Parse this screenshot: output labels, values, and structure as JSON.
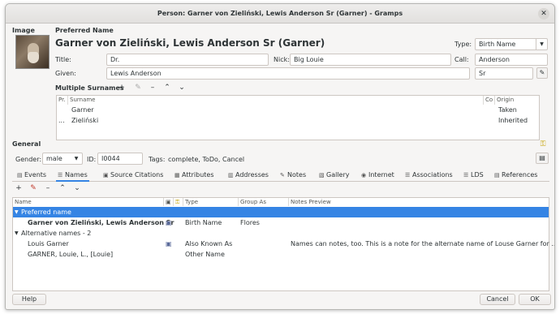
{
  "window": {
    "title": "Person: Garner von Zieliński, Lewis Anderson Sr (Garner) - Gramps"
  },
  "image_label": "Image",
  "preferred": {
    "section_label": "Preferred Name",
    "display_name": "Garner von Zieliński, Lewis Anderson Sr (Garner)",
    "type_label": "Type:",
    "type_value": "Birth Name",
    "title_label": "Title:",
    "title_value": "Dr.",
    "nick_label": "Nick:",
    "nick_value": "Big Louie",
    "call_label": "Call:",
    "call_value": "Anderson",
    "given_label": "Given:",
    "given_value": "Lewis Anderson",
    "suffix_value": "Sr"
  },
  "surnames": {
    "section_label": "Multiple Surnames",
    "col_pr": "Pr.",
    "col_surname": "Surname",
    "col_co": "Co",
    "col_origin": "Origin",
    "rows": [
      {
        "prefix": "",
        "surname": "Garner",
        "origin": "Taken"
      },
      {
        "prefix": "...",
        "surname": "Zieliński",
        "origin": "Inherited"
      }
    ]
  },
  "general": {
    "section_label": "General",
    "gender_label": "Gender:",
    "gender_value": "male",
    "id_label": "ID:",
    "id_value": "I0044",
    "tags_label": "Tags:",
    "tags_value": "complete, ToDo, Cancel"
  },
  "tabs": [
    {
      "label": "Events",
      "icon": "events-icon"
    },
    {
      "label": "Names",
      "icon": "names-icon"
    },
    {
      "label": "Source Citations",
      "icon": "citations-icon"
    },
    {
      "label": "Attributes",
      "icon": "attributes-icon"
    },
    {
      "label": "Addresses",
      "icon": "addresses-icon"
    },
    {
      "label": "Notes",
      "icon": "notes-icon"
    },
    {
      "label": "Gallery",
      "icon": "gallery-icon"
    },
    {
      "label": "Internet",
      "icon": "internet-icon"
    },
    {
      "label": "Associations",
      "icon": "associations-icon"
    },
    {
      "label": "LDS",
      "icon": "lds-icon"
    },
    {
      "label": "References",
      "icon": "references-icon"
    }
  ],
  "names_grid": {
    "headers": {
      "name": "Name",
      "type": "Type",
      "group_as": "Group As",
      "notes_preview": "Notes Preview"
    },
    "groups": [
      {
        "label": "Preferred name"
      },
      {
        "label": "Alternative names - 2"
      }
    ],
    "rows": [
      {
        "name": "Garner von Zieliński, Lewis Anderson Sr",
        "type": "Birth Name",
        "group_as": "Flores",
        "notes": ""
      },
      {
        "name": "Louis Garner",
        "type": "Also Known As",
        "group_as": "",
        "notes": "Names can notes, too. This is a note for the alternate name of Louse Garner for ..."
      },
      {
        "name": "GARNER, Louie, L., [Louie]",
        "type": "Other Name",
        "group_as": "",
        "notes": ""
      }
    ]
  },
  "buttons": {
    "help": "Help",
    "cancel": "Cancel",
    "ok": "OK"
  },
  "colors": {
    "accent": "#3584e4",
    "window_bg": "#f6f5f4"
  }
}
